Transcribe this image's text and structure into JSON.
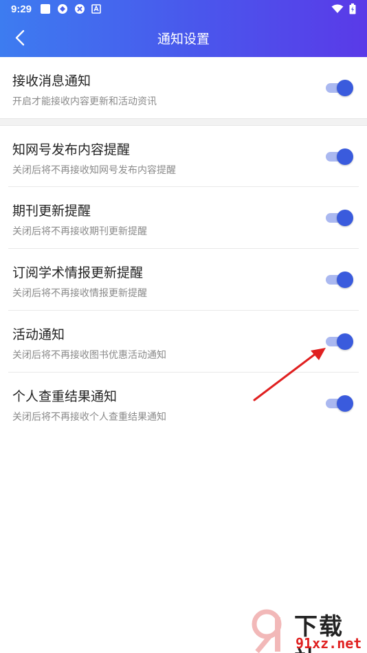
{
  "status_bar": {
    "time": "9:29",
    "icons": [
      "notification-square-icon",
      "app-icon-1",
      "app-icon-2",
      "app-icon-a"
    ],
    "right_icons": [
      "wifi-icon",
      "battery-charging-icon"
    ]
  },
  "app_bar": {
    "title": "通知设置",
    "back_icon": "chevron-left-icon",
    "gradient": [
      "#3d7cf0",
      "#5a3ae8"
    ]
  },
  "settings": [
    {
      "title": "接收消息通知",
      "desc": "开启才能接收内容更新和活动资讯",
      "enabled": true
    },
    {
      "title": "知网号发布内容提醒",
      "desc": "关闭后将不再接收知网号发布内容提醒",
      "enabled": true
    },
    {
      "title": "期刊更新提醒",
      "desc": "关闭后将不再接收期刊更新提醒",
      "enabled": true
    },
    {
      "title": "订阅学术情报更新提醒",
      "desc": "关闭后将不再接收情报更新提醒",
      "enabled": true
    },
    {
      "title": "活动通知",
      "desc": "关闭后将不再接收图书优惠活动通知",
      "enabled": true
    },
    {
      "title": "个人查重结果通知",
      "desc": "关闭后将不再接收个人查重结果通知",
      "enabled": true
    }
  ],
  "colors": {
    "toggle_thumb": "#3a5bdd",
    "toggle_track": "#aab8f0",
    "annotation_arrow": "#e02020"
  },
  "watermark": {
    "top": "下载站",
    "bottom": "91xz.net"
  }
}
